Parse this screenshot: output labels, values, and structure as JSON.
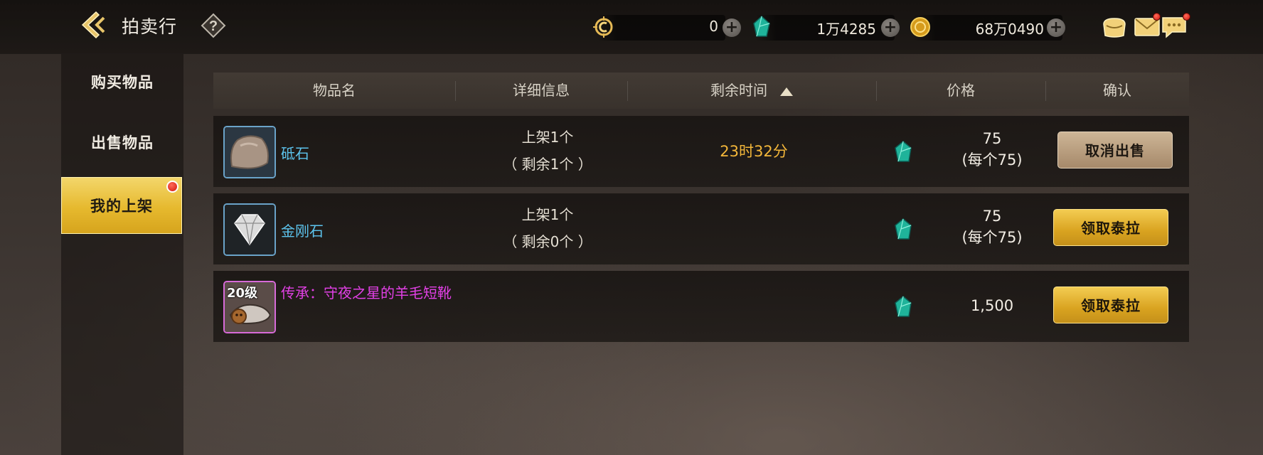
{
  "header": {
    "title": "拍卖行",
    "currencies": [
      {
        "name": "crest-currency",
        "value": "0"
      },
      {
        "name": "gem-currency",
        "value": "1万4285"
      },
      {
        "name": "gold-currency",
        "value": "68万0490"
      }
    ],
    "colors": {
      "accent": "#e6b92e",
      "legendary": "#e240e6",
      "rare": "#5dc4ee",
      "time": "#f4b73a"
    }
  },
  "sidebar": {
    "items": [
      {
        "label": "购买物品",
        "active": false
      },
      {
        "label": "出售物品",
        "active": false
      },
      {
        "label": "我的上架",
        "active": true
      }
    ]
  },
  "table": {
    "columns": [
      "物品名",
      "详细信息",
      "剩余时间",
      "价格",
      "确认"
    ],
    "rows": [
      {
        "name": "砥石",
        "detail_line1": "上架1个",
        "detail_line2": "（ 剩余1个 ）",
        "time": "23时32分",
        "price_line1": "75",
        "price_line2": "(每个75)",
        "action": "取消出售"
      },
      {
        "name": "金刚石",
        "detail_line1": "上架1个",
        "detail_line2": "（ 剩余0个 ）",
        "time": "",
        "price_line1": "75",
        "price_line2": "(每个75)",
        "action": "领取泰拉"
      },
      {
        "level": "20级",
        "name": "传承：守夜之星的羊毛短靴",
        "detail_line1": "",
        "detail_line2": "",
        "time": "",
        "price_line1": "1,500",
        "price_line2": "",
        "action": "领取泰拉"
      }
    ]
  }
}
